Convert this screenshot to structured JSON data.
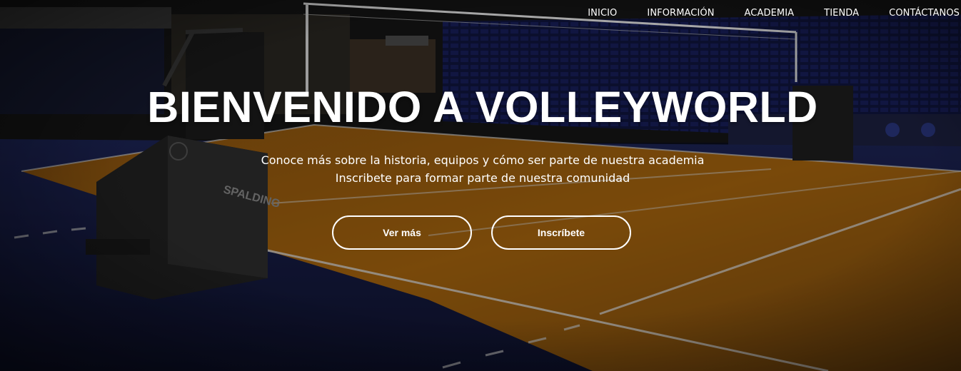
{
  "nav": {
    "items": [
      {
        "label": "INICIO"
      },
      {
        "label": "INFORMACIÓN"
      },
      {
        "label": "ACADEMIA"
      },
      {
        "label": "TIENDA"
      },
      {
        "label": "CONTÁCTANOS"
      }
    ]
  },
  "hero": {
    "title": "BIENVENIDO A VOLLEYWORLD",
    "subtitle_line1": "Conoce más sobre la historia, equipos y cómo ser parte de nuestra academia",
    "subtitle_line2": "Inscribete para formar parte de nuestra comunidad",
    "primary_button": "Ver más",
    "secondary_button": "Inscríbete",
    "background_image": "volleyball-court-arena-photo",
    "colors": {
      "court_orange": "#b8710e",
      "court_blue": "#1c2559",
      "seats_blue": "#1e2a6e",
      "button_border": "#ffffff"
    }
  }
}
